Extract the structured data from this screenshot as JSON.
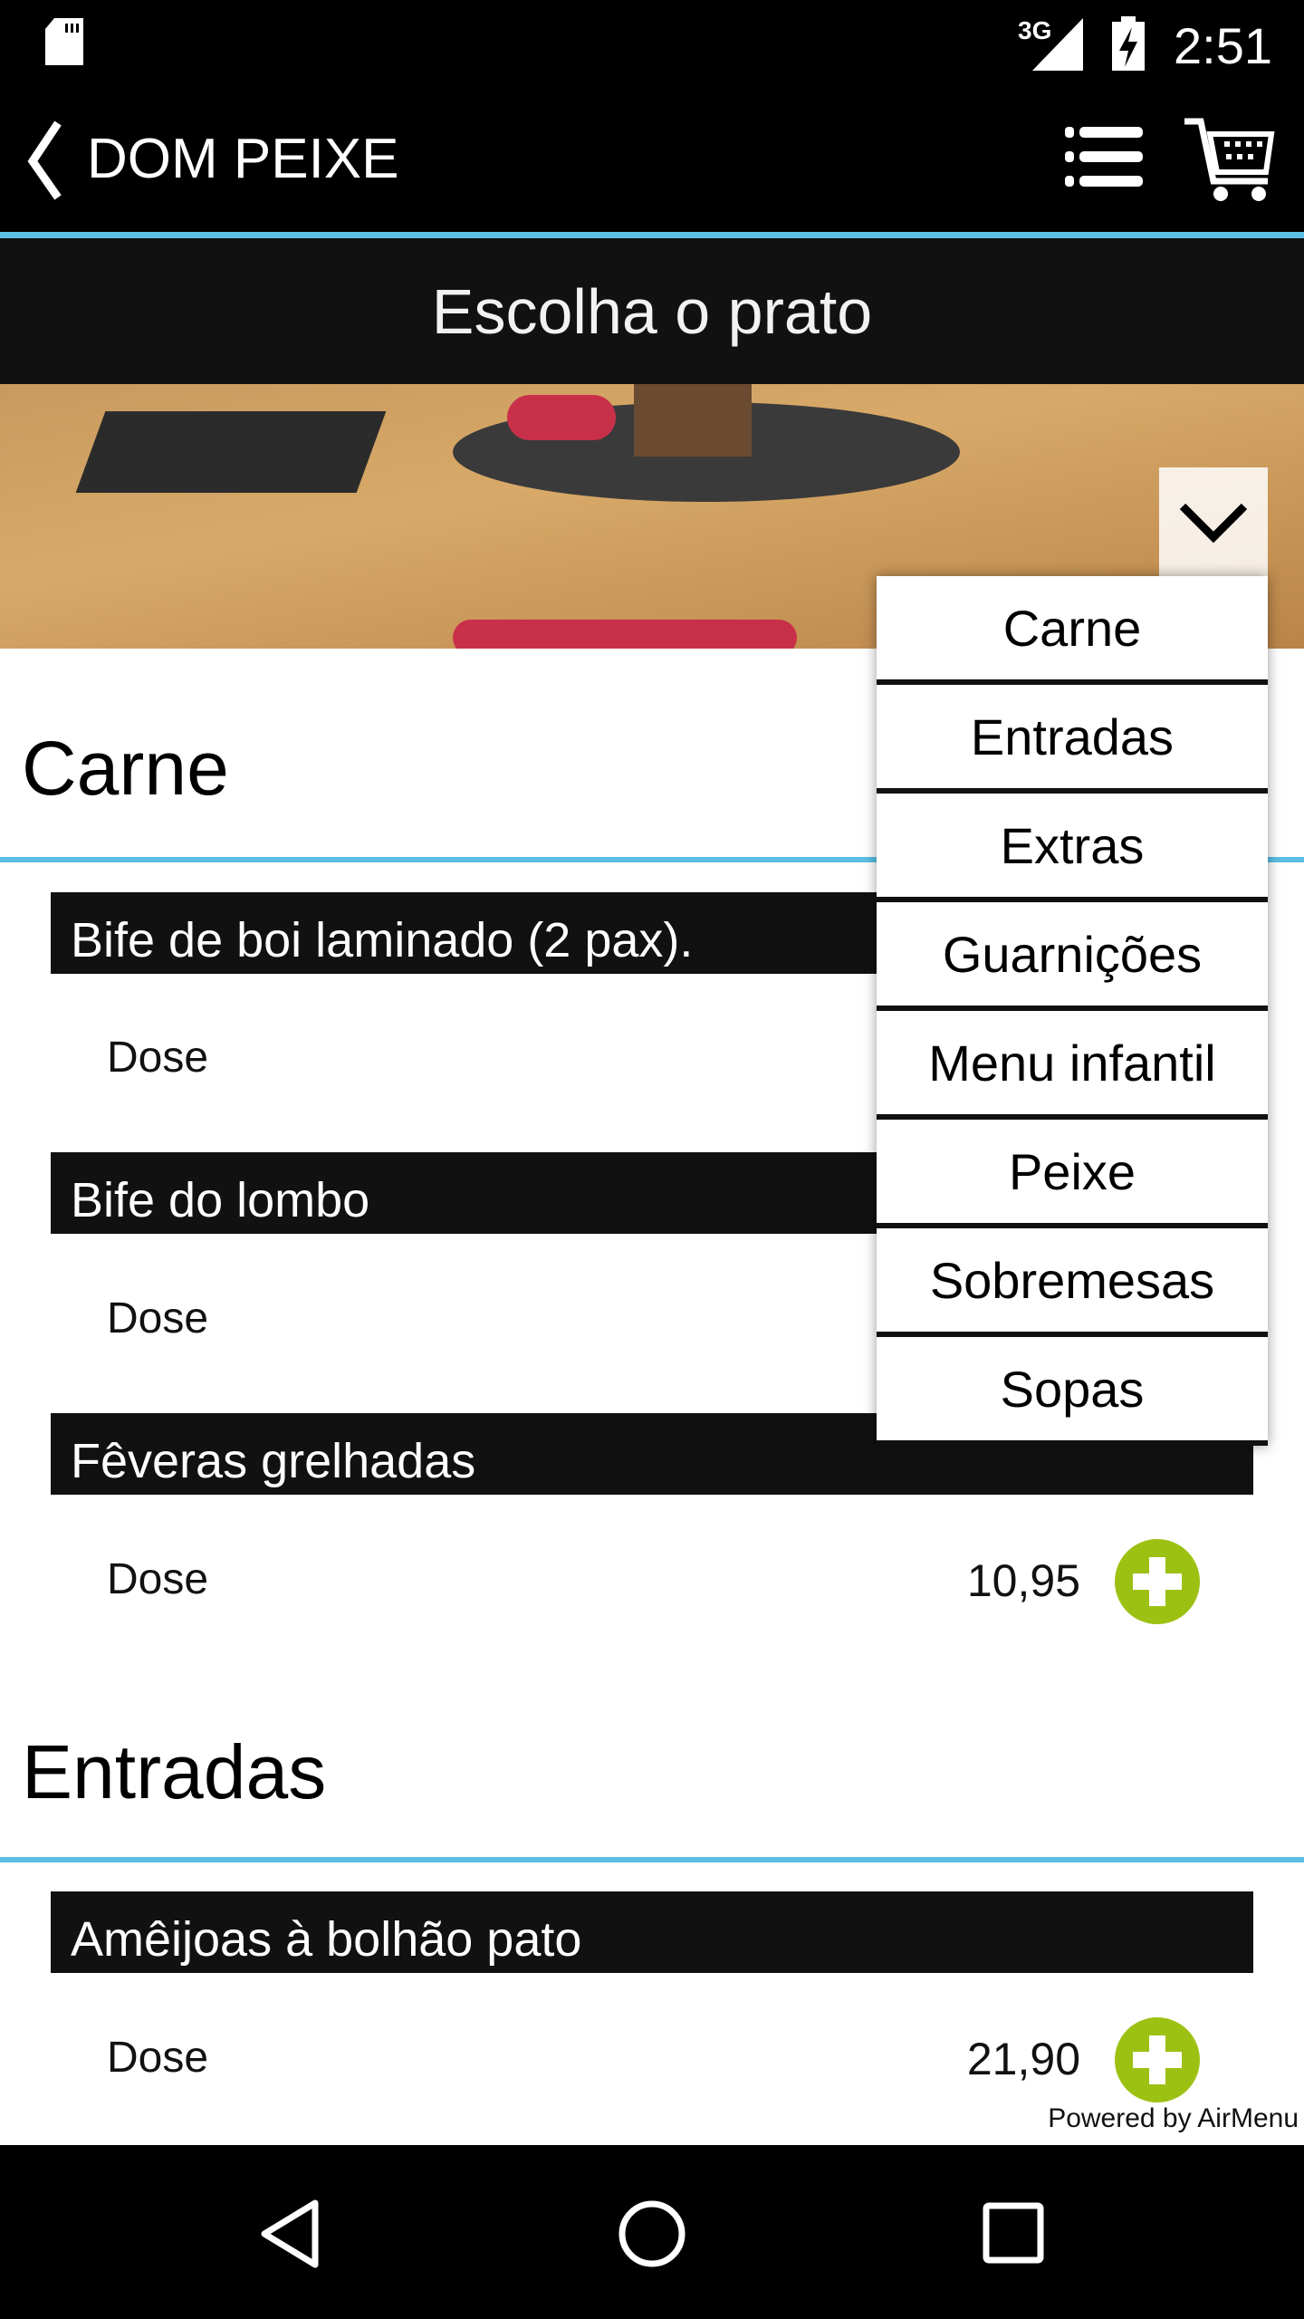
{
  "status_bar": {
    "time": "2:51",
    "network": "3G",
    "icons": [
      "sd-card-icon",
      "signal-icon",
      "battery-charging-icon"
    ]
  },
  "app_bar": {
    "title": "DOM PEIXE",
    "icons": [
      "back-chevron-icon",
      "list-menu-icon",
      "cart-icon"
    ]
  },
  "page_title": "Escolha o prato",
  "sections": [
    {
      "title": "Carne",
      "items": [
        {
          "name": "Bife de boi laminado (2 pax).",
          "portion": "Dose"
        },
        {
          "name": "Bife do lombo",
          "portion": "Dose"
        },
        {
          "name": "Fêveras grelhadas",
          "portion": "Dose",
          "price": "10,95"
        }
      ]
    },
    {
      "title": "Entradas",
      "items": [
        {
          "name": "Amêijoas à bolhão pato",
          "portion": "Dose",
          "price": "21,90"
        }
      ]
    }
  ],
  "category_dropdown": {
    "open": true,
    "options": [
      "Carne",
      "Entradas",
      "Extras",
      "Guarnições",
      "Menu infantil",
      "Peixe",
      "Sobremesas",
      "Sopas"
    ]
  },
  "footer": {
    "powered_by": "Powered by AirMenu"
  },
  "colors": {
    "accent_blue": "#5bbfe3",
    "add_green": "#9dc113",
    "header_dark": "#111111"
  }
}
